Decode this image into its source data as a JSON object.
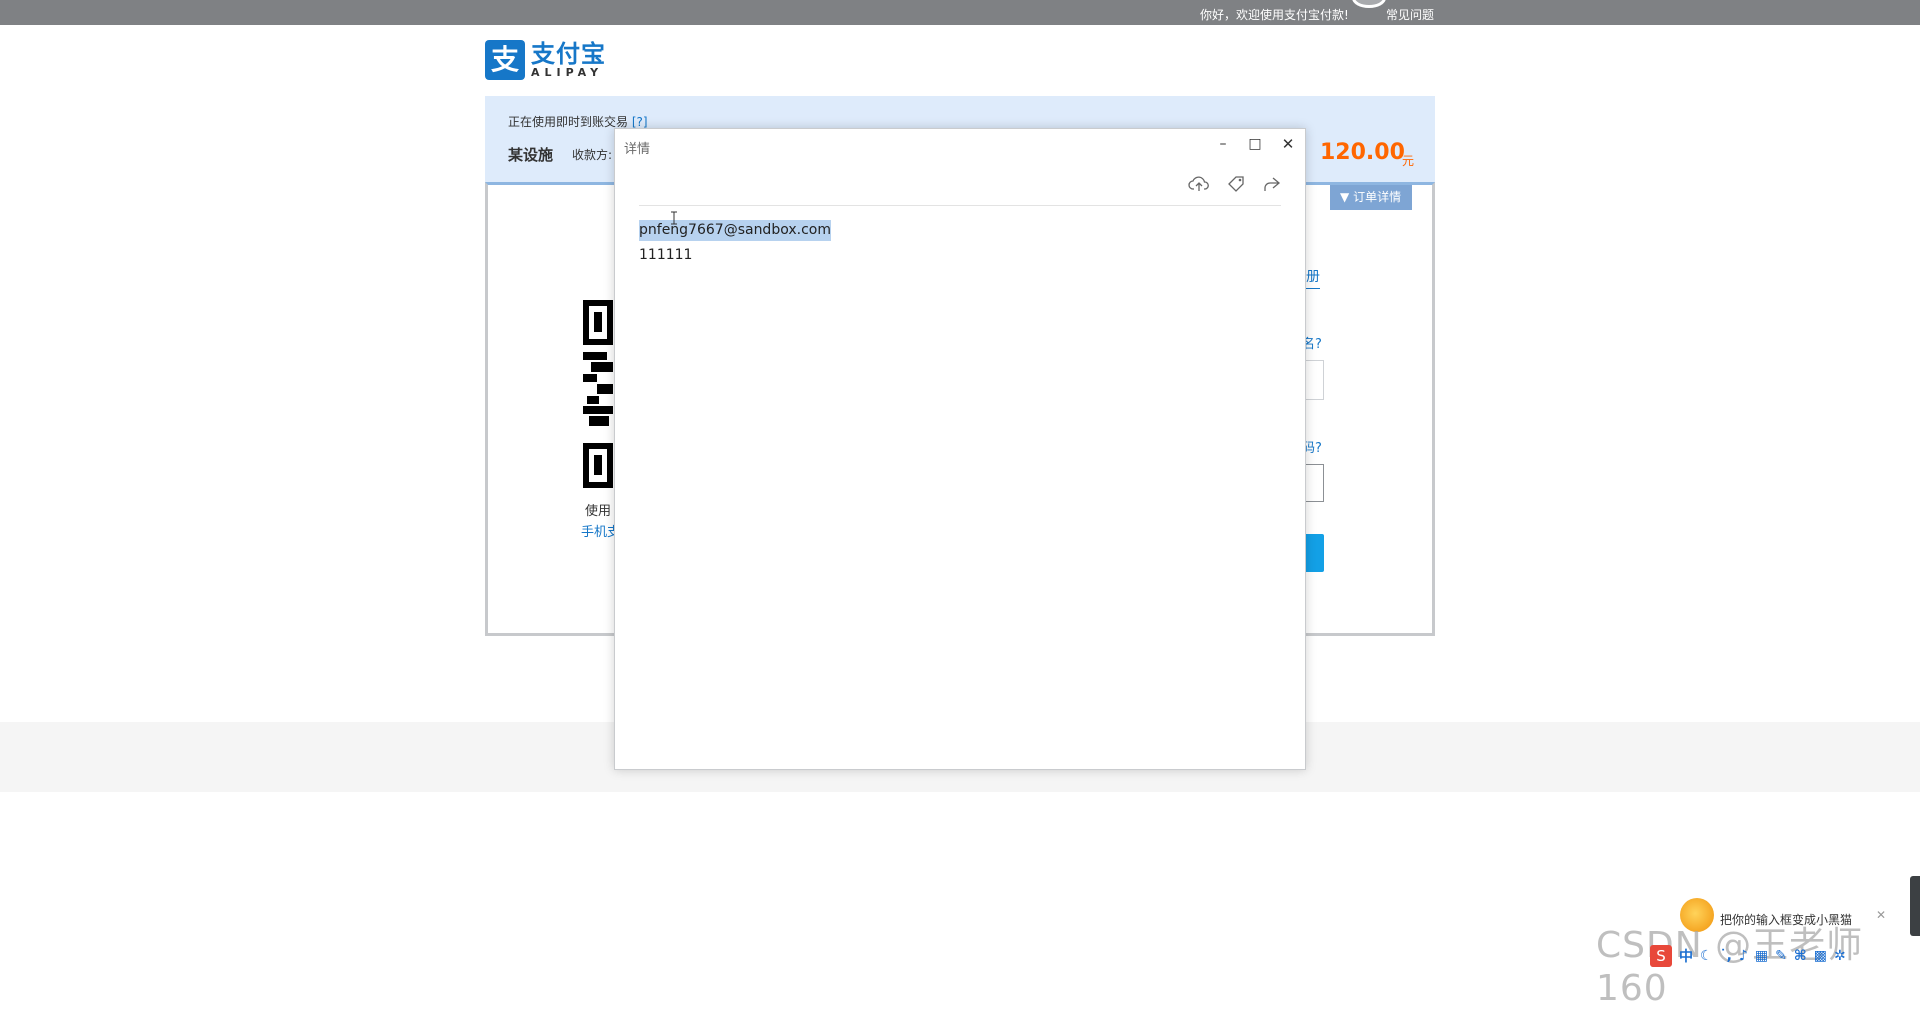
{
  "topbar": {
    "welcome": "你好，欢迎使用支付宝付款!",
    "faq": "常见问题"
  },
  "logo": {
    "mark": "支",
    "cn": "支付宝",
    "en": "ALIPAY"
  },
  "order": {
    "tip": "正在使用即时到账交易",
    "tip_help": "[?]",
    "merchant": "某设施",
    "payee_label": "收款方:",
    "amount": "120.00",
    "unit": "元",
    "detail_button": "订单详情"
  },
  "qr": {
    "label_prefix": "使用",
    "label_link": "手机支"
  },
  "right_fragments": {
    "register": "册",
    "q1": "名?",
    "q2": "码?"
  },
  "detail_window": {
    "title": "详情",
    "email": "pnfeng7667@sandbox.com",
    "number": "111111",
    "controls": {
      "minimize": "–",
      "maximize": "□",
      "close": "✕"
    }
  },
  "ime": {
    "tip": "把你的输入框变成小黑猫",
    "close": "✕",
    "logo": "S",
    "mode": "中"
  },
  "watermark": "CSDN @王老师160"
}
